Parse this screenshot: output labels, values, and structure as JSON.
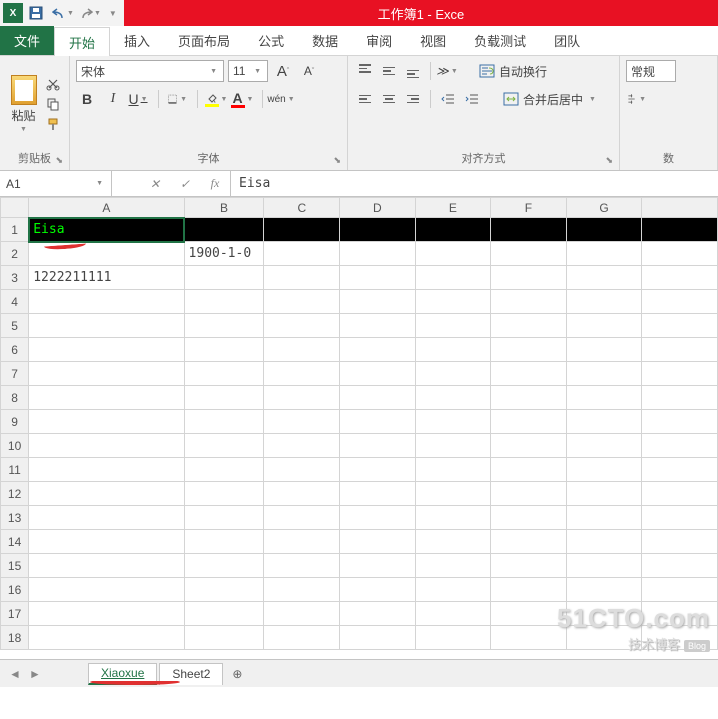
{
  "title": "工作簿1 - Exce",
  "tabs": {
    "file": "文件",
    "home": "开始",
    "insert": "插入",
    "layout": "页面布局",
    "formulas": "公式",
    "data": "数据",
    "review": "审阅",
    "view": "视图",
    "loadtest": "负载测试",
    "team": "团队"
  },
  "ribbon": {
    "clipboard": {
      "paste": "粘贴",
      "label": "剪贴板"
    },
    "font": {
      "name": "宋体",
      "size": "11",
      "bold": "B",
      "italic": "I",
      "underline": "U",
      "bigA": "A",
      "smallA": "A",
      "fontA": "A",
      "colorA": "A",
      "wen": "wén",
      "label": "字体"
    },
    "align": {
      "wrap": "自动换行",
      "merge": "合并后居中",
      "label": "对齐方式"
    },
    "number": {
      "format": "常规",
      "label": "数"
    }
  },
  "namebox": "A1",
  "formula": "Eisa",
  "columns": [
    "A",
    "B",
    "C",
    "D",
    "E",
    "F",
    "G"
  ],
  "rows_count": 18,
  "cells": {
    "A1": "Eisa",
    "B2": "1900-1-0",
    "A3": "1222211111"
  },
  "sheets": {
    "s1": "Xiaoxue",
    "s2": "Sheet2"
  },
  "watermark": {
    "big": "51CTO.com",
    "small": "技术博客",
    "blog": "Blog"
  }
}
